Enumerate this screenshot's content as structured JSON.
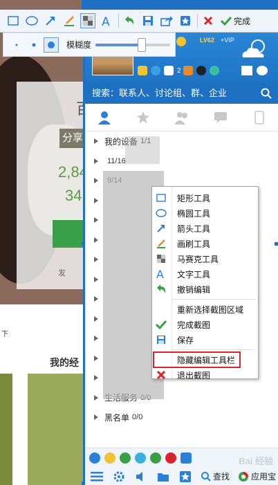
{
  "toolbar": {
    "tools": [
      "rectangle-icon",
      "ellipse-icon",
      "arrow-icon",
      "brush-icon",
      "mosaic-icon",
      "text-icon"
    ],
    "actions": [
      "undo-icon",
      "save-icon",
      "share-icon",
      "pin-icon"
    ],
    "cancel": "cancel-icon",
    "done_label": "完成"
  },
  "subbar": {
    "blur_label": "模糊度",
    "blur_level": 0.62,
    "sizes": [
      "small",
      "medium",
      "large"
    ],
    "selected_size": "large"
  },
  "qq": {
    "lv": "LV62",
    "vip": "+VIP",
    "mail_count": "2",
    "search_text": "搜索：联系人、讨论组、群、企业",
    "groups": [
      {
        "label": "我的设备",
        "count": "1/1"
      },
      {
        "label": "",
        "count": "11/16"
      },
      {
        "label": "",
        "count": "9/14"
      },
      {
        "label": "",
        "count": ""
      },
      {
        "label": "",
        "count": ""
      },
      {
        "label": "",
        "count": ""
      },
      {
        "label": "",
        "count": ""
      },
      {
        "label": "",
        "count": ""
      },
      {
        "label": "",
        "count": ""
      },
      {
        "label": "",
        "count": ""
      },
      {
        "label": "",
        "count": ""
      },
      {
        "label": "",
        "count": ""
      },
      {
        "label": "",
        "count": ""
      },
      {
        "label": "生活服务",
        "count": "0/0"
      },
      {
        "label": "黑名单",
        "count": "0/0"
      }
    ],
    "footer": {
      "find_label": "查找",
      "appstore_label": "应用宝",
      "watermark": "Bai 经验"
    }
  },
  "menu": {
    "items": [
      {
        "label": "矩形工具",
        "icon": "rectangle-icon"
      },
      {
        "label": "椭圆工具",
        "icon": "ellipse-icon"
      },
      {
        "label": "箭头工具",
        "icon": "arrow-icon"
      },
      {
        "label": "画刷工具",
        "icon": "brush-icon"
      },
      {
        "label": "马赛克工具",
        "icon": "mosaic-icon"
      },
      {
        "label": "文字工具",
        "icon": "text-icon"
      },
      {
        "label": "撤销编辑",
        "icon": "undo-icon"
      },
      {
        "label": "重新选择截图区域",
        "icon": ""
      },
      {
        "label": "完成截图",
        "icon": "check-icon"
      },
      {
        "label": "保存",
        "icon": "save-icon"
      },
      {
        "label": "隐藏编辑工具栏",
        "icon": ""
      },
      {
        "label": "退出截图",
        "icon": "close-icon"
      }
    ]
  },
  "background": {
    "share_text": "分享",
    "num1": "2,84",
    "num2": "34",
    "char": "百",
    "tiny_text": "发",
    "lower_text": "我的经",
    "xia": "下"
  },
  "colors": {
    "qq_blue": "#1f74c8",
    "highlight_red": "#d9232d",
    "tool_blue": "#2a7fd6",
    "check_green": "#3aa048"
  }
}
